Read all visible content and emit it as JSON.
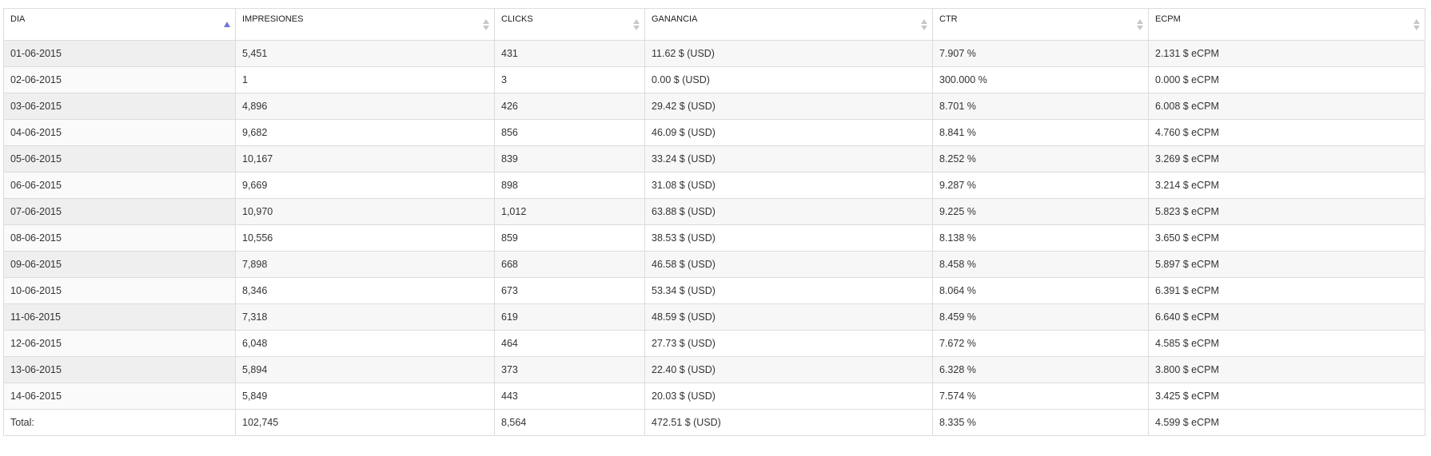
{
  "columns": [
    {
      "label": "DIA",
      "sort": "asc"
    },
    {
      "label": "IMPRESIONES",
      "sort": "none"
    },
    {
      "label": "CLICKS",
      "sort": "none"
    },
    {
      "label": "GANANCIA",
      "sort": "none"
    },
    {
      "label": "CTR",
      "sort": "none"
    },
    {
      "label": "ECPM",
      "sort": "none"
    }
  ],
  "rows": [
    [
      "01-06-2015",
      "5,451",
      "431",
      "11.62 $ (USD)",
      "7.907 %",
      "2.131 $ eCPM"
    ],
    [
      "02-06-2015",
      "1",
      "3",
      "0.00 $ (USD)",
      "300.000 %",
      "0.000 $ eCPM"
    ],
    [
      "03-06-2015",
      "4,896",
      "426",
      "29.42 $ (USD)",
      "8.701 %",
      "6.008 $ eCPM"
    ],
    [
      "04-06-2015",
      "9,682",
      "856",
      "46.09 $ (USD)",
      "8.841 %",
      "4.760 $ eCPM"
    ],
    [
      "05-06-2015",
      "10,167",
      "839",
      "33.24 $ (USD)",
      "8.252 %",
      "3.269 $ eCPM"
    ],
    [
      "06-06-2015",
      "9,669",
      "898",
      "31.08 $ (USD)",
      "9.287 %",
      "3.214 $ eCPM"
    ],
    [
      "07-06-2015",
      "10,970",
      "1,012",
      "63.88 $ (USD)",
      "9.225 %",
      "5.823 $ eCPM"
    ],
    [
      "08-06-2015",
      "10,556",
      "859",
      "38.53 $ (USD)",
      "8.138 %",
      "3.650 $ eCPM"
    ],
    [
      "09-06-2015",
      "7,898",
      "668",
      "46.58 $ (USD)",
      "8.458 %",
      "5.897 $ eCPM"
    ],
    [
      "10-06-2015",
      "8,346",
      "673",
      "53.34 $ (USD)",
      "8.064 %",
      "6.391 $ eCPM"
    ],
    [
      "11-06-2015",
      "7,318",
      "619",
      "48.59 $ (USD)",
      "8.459 %",
      "6.640 $ eCPM"
    ],
    [
      "12-06-2015",
      "6,048",
      "464",
      "27.73 $ (USD)",
      "7.672 %",
      "4.585 $ eCPM"
    ],
    [
      "13-06-2015",
      "5,894",
      "373",
      "22.40 $ (USD)",
      "6.328 %",
      "3.800 $ eCPM"
    ],
    [
      "14-06-2015",
      "5,849",
      "443",
      "20.03 $ (USD)",
      "7.574 %",
      "3.425 $ eCPM"
    ]
  ],
  "totals": [
    "Total:",
    "102,745",
    "8,564",
    "472.51 $ (USD)",
    "8.335 %",
    "4.599 $ eCPM"
  ],
  "colors": {
    "sort_active": "#6b7ad6",
    "sort_inactive": "#c8c8c8",
    "border": "#dcdcdc"
  }
}
